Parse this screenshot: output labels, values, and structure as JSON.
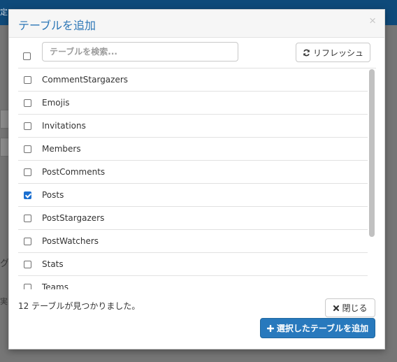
{
  "background": {
    "topbar_text": "定",
    "side_text_1": "グ",
    "side_text_2": "実"
  },
  "modal": {
    "title": "テーブルを追加",
    "close_glyph": "×",
    "search": {
      "placeholder": "テーブルを検索...",
      "value": ""
    },
    "refresh_label": "リフレッシュ",
    "tables": [
      {
        "name": "CommentStargazers",
        "checked": false
      },
      {
        "name": "Emojis",
        "checked": false
      },
      {
        "name": "Invitations",
        "checked": false
      },
      {
        "name": "Members",
        "checked": false
      },
      {
        "name": "PostComments",
        "checked": false
      },
      {
        "name": "Posts",
        "checked": true
      },
      {
        "name": "PostStargazers",
        "checked": false
      },
      {
        "name": "PostWatchers",
        "checked": false
      },
      {
        "name": "Stats",
        "checked": false
      },
      {
        "name": "Teams",
        "checked": false
      }
    ],
    "found_text": "12 テーブルが見つかりました。",
    "close_button_label": "閉じる",
    "add_button_label": "選択したテーブルを追加"
  },
  "colors": {
    "accent": "#2879bd",
    "title": "#2b76b6",
    "checkbox_checked": "#1b6fd0",
    "overlay": "#767676"
  },
  "icons": {
    "refresh": "refresh-icon",
    "close": "times-icon",
    "add": "plus-icon"
  }
}
